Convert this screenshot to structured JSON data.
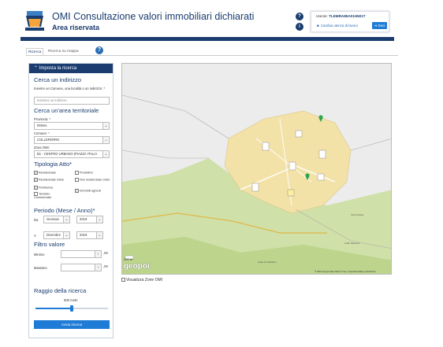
{
  "header": {
    "title": "OMI Consultazione valori immobiliari dichiarati",
    "subtitle": "Area riservata",
    "user_prefix": "Utente:",
    "user_code": "TLEMRA85A01H501T",
    "cambia_label": "Cambia utenza di lavoro",
    "esci_label": "Esci",
    "help_icon_1": "?",
    "help_icon_2": "i"
  },
  "tabs": [
    {
      "label": "Ricerca"
    },
    {
      "label": "Ricerca su mappa"
    }
  ],
  "help_label": "?",
  "panel": {
    "head": "Imposta la ricerca",
    "addr_title": "Cerca un indirizzo",
    "addr_help": "Inserire un Comune, una località o un indirizzo: *",
    "addr_placeholder": "Inserisci un indirizzo",
    "area_title": "Cerca un'area territoriale",
    "provincia_label": "Provincia: *",
    "provincia_value": "ROMA",
    "comune_label": "Comune: *",
    "comune_value": "COLLEFERRO",
    "zona_label": "Zona OMI:",
    "zona_value": "B1 - CENTRO URBANO (PIAZZA ITALIA",
    "tipologia_title": "Tipologia Atto*",
    "checks": [
      {
        "label": "Residenziale",
        "checked": true
      },
      {
        "label": "Produttivo",
        "checked": false
      },
      {
        "label": "Residenziale misto",
        "checked": true
      },
      {
        "label": "Non residenziale misto",
        "checked": false
      },
      {
        "label": "Pertinenza",
        "checked": true
      },
      {
        "label": "Immobili agricoli",
        "checked": true
      },
      {
        "label": "Terziario Commerciale",
        "checked": false
      }
    ],
    "periodo_title": "Periodo (Mese / Anno)*",
    "da_label": "Da",
    "da_mese": "Gennaio",
    "da_anno": "2019",
    "a_label": "A",
    "a_mese": "Dicembre",
    "a_anno": "2019",
    "filtro_title": "Filtro valore",
    "minimo_label": "Minimo",
    "massimo_label": "Massimo",
    "euro_suffix": ",00",
    "raggio_title": "Raggio della ricerca",
    "raggio_value": "600 metri",
    "raggio_fraction": 0.5,
    "button_label": "Avvia ricerca"
  },
  "map": {
    "scale_label": "200 m",
    "brand": "geopoi",
    "labels": [
      "Colle di Colleferro",
      "Colle Sassone",
      "Via Fontana"
    ],
    "attribution": "© 2019 Geopoi Map Data © here, OpenStreetMap contributors",
    "checkbox_label": "Visualizza Zone OMI"
  },
  "colors": {
    "primary": "#1a3c6e",
    "button": "#1e7bd6",
    "map_zone": "#f3e2a8"
  }
}
